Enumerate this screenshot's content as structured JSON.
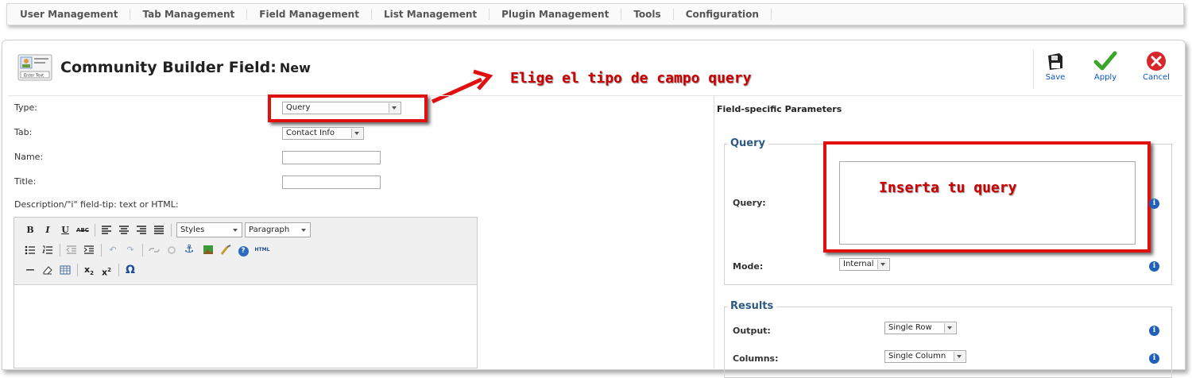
{
  "topnav": {
    "items": [
      "User Management",
      "Tab Management",
      "Field Management",
      "List Management",
      "Plugin Management",
      "Tools",
      "Configuration"
    ]
  },
  "header": {
    "title": "Community Builder Field:",
    "subtitle": "New",
    "icon_caption": "Enter Text"
  },
  "toolbar": {
    "save_label": "Save",
    "apply_label": "Apply",
    "cancel_label": "Cancel"
  },
  "annotations": {
    "type_hint": "Elige el tipo de campo query",
    "query_hint": "Inserta tu query",
    "color": "#cc0000"
  },
  "form": {
    "type_label": "Type:",
    "type_value": "Query",
    "tab_label": "Tab:",
    "tab_value": "Contact Info",
    "name_label": "Name:",
    "name_value": "",
    "title_label": "Title:",
    "title_value": "",
    "description_label": "Description/\"i\" field-tip: text or HTML:"
  },
  "editor": {
    "styles_value": "Styles",
    "format_value": "Paragraph",
    "html_label": "HTML"
  },
  "params": {
    "title": "Field-specific Parameters",
    "query_legend": "Query",
    "query_label": "Query:",
    "query_value": "",
    "mode_label": "Mode:",
    "mode_value": "Internal",
    "results_legend": "Results",
    "output_label": "Output:",
    "output_value": "Single Row",
    "columns_label": "Columns:",
    "columns_value": "Single Column"
  },
  "colors": {
    "legend": "#2c5a85",
    "link": "#0b55c4",
    "highlight": "#e11010",
    "info": "#1f60b8"
  }
}
